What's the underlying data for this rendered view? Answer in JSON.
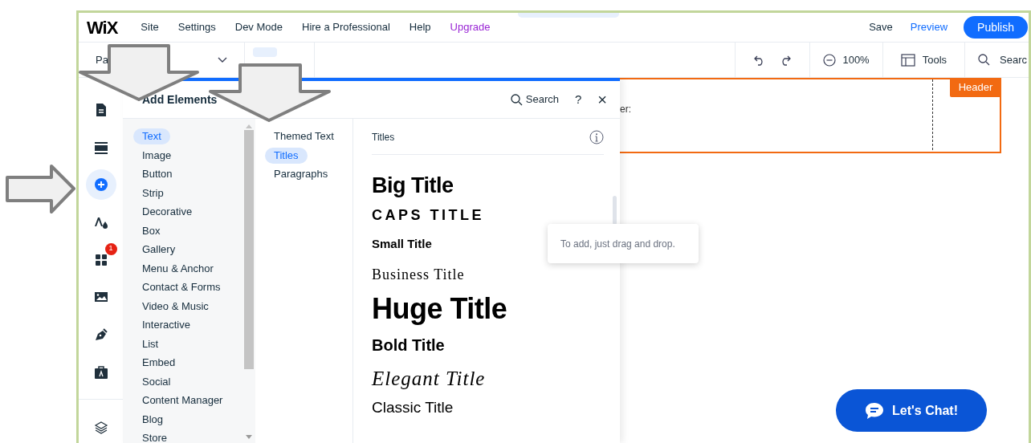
{
  "menu": {
    "logo": "WiX",
    "items": [
      {
        "label": "Site",
        "kind": "plain"
      },
      {
        "label": "Settings",
        "kind": "plain"
      },
      {
        "label": "Dev Mode",
        "kind": "plain"
      },
      {
        "label": "Hire a Professional",
        "kind": "plain"
      },
      {
        "label": "Help",
        "kind": "plain"
      },
      {
        "label": "Upgrade",
        "kind": "upgrade"
      }
    ],
    "save": "Save",
    "preview": "Preview",
    "publish": "Publish"
  },
  "toolbar": {
    "page_selector": "Pa",
    "zoom": "100%",
    "tools": "Tools",
    "search": "Searc"
  },
  "rail": [
    {
      "kind": "pages",
      "selected": false
    },
    {
      "kind": "sections",
      "selected": false
    },
    {
      "kind": "add",
      "selected": true
    },
    {
      "kind": "design",
      "selected": false
    },
    {
      "kind": "apps",
      "selected": false,
      "badge": "1"
    },
    {
      "kind": "media",
      "selected": false
    },
    {
      "kind": "pen",
      "selected": false
    },
    {
      "kind": "portfolio",
      "selected": false
    },
    {
      "kind": "layers",
      "selected": false
    }
  ],
  "panel": {
    "title": "Add Elements",
    "search": "Search",
    "help": "?",
    "close": "×",
    "categories": [
      {
        "label": "Text",
        "selected": true
      },
      {
        "label": "Image",
        "selected": false
      },
      {
        "label": "Button",
        "selected": false
      },
      {
        "label": "Strip",
        "selected": false
      },
      {
        "label": "Decorative",
        "selected": false
      },
      {
        "label": "Box",
        "selected": false
      },
      {
        "label": "Gallery",
        "selected": false
      },
      {
        "label": "Menu & Anchor",
        "selected": false
      },
      {
        "label": "Contact & Forms",
        "selected": false
      },
      {
        "label": "Video & Music",
        "selected": false
      },
      {
        "label": "Interactive",
        "selected": false
      },
      {
        "label": "List",
        "selected": false
      },
      {
        "label": "Embed",
        "selected": false
      },
      {
        "label": "Social",
        "selected": false
      },
      {
        "label": "Content Manager",
        "selected": false
      },
      {
        "label": "Blog",
        "selected": false
      },
      {
        "label": "Store",
        "selected": false
      }
    ],
    "subcategories": [
      {
        "label": "Themed Text",
        "selected": false
      },
      {
        "label": "Titles",
        "selected": true
      },
      {
        "label": "Paragraphs",
        "selected": false
      }
    ],
    "section_title": "Titles",
    "titles": [
      {
        "label": "Big Title",
        "kind": "big"
      },
      {
        "label": "CAPS TITLE",
        "kind": "caps"
      },
      {
        "label": "Small Title",
        "kind": "small"
      },
      {
        "label": "Business Title",
        "kind": "business"
      },
      {
        "label": "Huge Title",
        "kind": "huge"
      },
      {
        "label": "Bold Title",
        "kind": "bold"
      },
      {
        "label": "Elegant Title",
        "kind": "elegant"
      },
      {
        "label": "Classic Title",
        "kind": "classic"
      }
    ],
    "tooltip": "To add, just drag and drop."
  },
  "canvas": {
    "header_text": "er:",
    "header_badge": "Header"
  },
  "chat_button": "Let's Chat!"
}
